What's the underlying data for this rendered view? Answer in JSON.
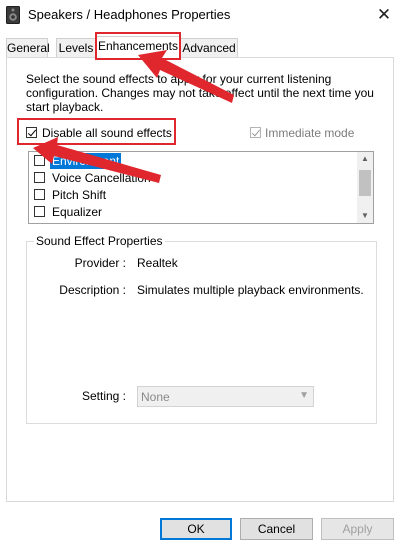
{
  "window": {
    "title": "Speakers / Headphones Properties",
    "close_glyph": "✕"
  },
  "tabs": [
    {
      "label": "General"
    },
    {
      "label": "Levels"
    },
    {
      "label": "Enhancements"
    },
    {
      "label": "Advanced"
    }
  ],
  "active_tab": "Enhancements",
  "enhancements": {
    "intro": "Select the sound effects to apply for your current listening configuration. Changes may not take effect until the next time you start playback.",
    "disable_all": {
      "label": "Disable all sound effects",
      "checked": true
    },
    "immediate_mode": {
      "label": "Immediate mode",
      "checked": true,
      "enabled": false
    },
    "effects": [
      {
        "label": "Environment",
        "checked": false,
        "selected": true
      },
      {
        "label": "Voice Cancellation",
        "checked": false
      },
      {
        "label": "Pitch Shift",
        "checked": false
      },
      {
        "label": "Equalizer",
        "checked": false
      }
    ],
    "properties": {
      "title": "Sound Effect Properties",
      "provider_label": "Provider :",
      "provider_value": "Realtek",
      "description_label": "Description :",
      "description_value": "Simulates multiple playback environments.",
      "setting_label": "Setting :",
      "setting_value": "None"
    }
  },
  "buttons": {
    "ok": "OK",
    "cancel": "Cancel",
    "apply": "Apply"
  },
  "annotation_color": "#e0272d",
  "icons": {
    "window": "speaker-icon",
    "close": "close-icon",
    "dropdown": "chevron-down-icon"
  }
}
